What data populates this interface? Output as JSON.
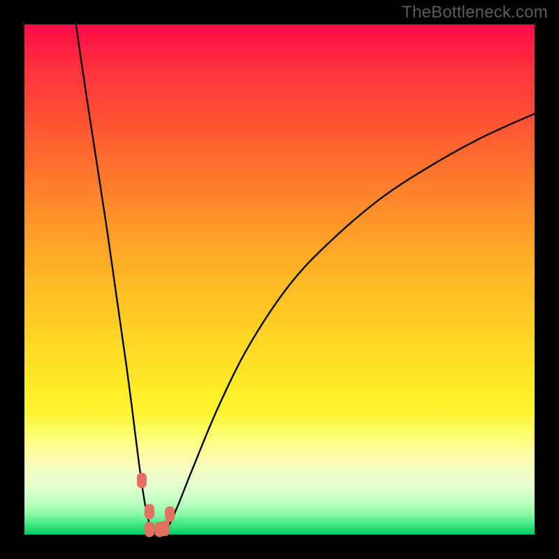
{
  "watermark": "TheBottleneck.com",
  "chart_data": {
    "type": "line",
    "title": "",
    "xlabel": "",
    "ylabel": "",
    "xlim": [
      0,
      100
    ],
    "ylim": [
      0,
      100
    ],
    "grid": false,
    "legend": false,
    "series": [
      {
        "name": "curve-left",
        "x": [
          10.1,
          12.0,
          14.0,
          16.0,
          18.0,
          19.0,
          20.0,
          21.0,
          22.0,
          23.0,
          24.0,
          25.0,
          26.0
        ],
        "values": [
          100.0,
          87.0,
          74.0,
          61.0,
          47.0,
          40.0,
          33.0,
          25.5,
          17.5,
          10.0,
          4.0,
          1.0,
          0.0
        ]
      },
      {
        "name": "curve-right",
        "x": [
          27.0,
          28.0,
          30.0,
          33.0,
          38.0,
          44.0,
          52.0,
          60.0,
          70.0,
          80.0,
          90.0,
          100.0
        ],
        "values": [
          0.0,
          1.2,
          5.5,
          13.0,
          25.0,
          37.0,
          49.0,
          57.5,
          66.0,
          72.5,
          78.0,
          82.5
        ]
      }
    ],
    "markers": {
      "name": "highlight-points",
      "x": [
        23.0,
        24.5,
        26.5,
        28.5,
        24.5,
        27.5
      ],
      "values": [
        10.6,
        4.5,
        1.0,
        4.0,
        1.0,
        1.2
      ]
    },
    "colors": {
      "curve": "#000000",
      "marker": "#e2705f",
      "background_top": "#ff0a4a",
      "background_bottom": "#08c46b"
    }
  }
}
